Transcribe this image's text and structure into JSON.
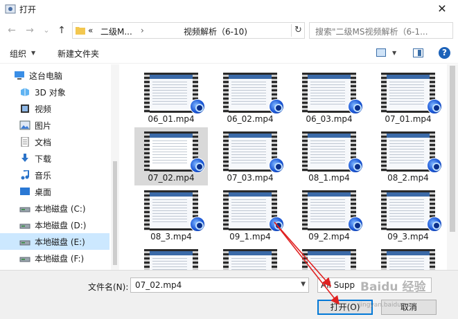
{
  "window": {
    "title": "打开",
    "close_glyph": "✕"
  },
  "nav": {
    "back_glyph": "←",
    "forward_glyph": "→",
    "recent_glyph": "⌄",
    "up_glyph": "↑",
    "crumbs": [
      "«",
      "二级M...",
      "›",
      "视频解析（6-10)"
    ],
    "dropdown_glyph": "⌄",
    "refresh_glyph": "↻"
  },
  "search": {
    "placeholder": "搜索\"二级MS视频解析（6-1..."
  },
  "toolbar": {
    "organize": "组织",
    "organize_arrow": "▼",
    "new_folder": "新建文件夹",
    "view_arrow": "▼",
    "help": "?"
  },
  "sidebar": {
    "items": [
      {
        "label": "这台电脑",
        "icon": "computer-icon"
      },
      {
        "label": "3D 对象",
        "icon": "cube-3d-icon"
      },
      {
        "label": "视频",
        "icon": "video-folder-icon"
      },
      {
        "label": "图片",
        "icon": "picture-folder-icon"
      },
      {
        "label": "文档",
        "icon": "document-folder-icon"
      },
      {
        "label": "下载",
        "icon": "download-arrow-icon"
      },
      {
        "label": "音乐",
        "icon": "music-note-icon"
      },
      {
        "label": "桌面",
        "icon": "desktop-icon"
      },
      {
        "label": "本地磁盘 (C:)",
        "icon": "drive-icon"
      },
      {
        "label": "本地磁盘 (D:)",
        "icon": "drive-icon"
      },
      {
        "label": "本地磁盘 (E:)",
        "icon": "drive-icon"
      },
      {
        "label": "本地磁盘 (F:)",
        "icon": "drive-icon"
      }
    ],
    "selected_index": 10
  },
  "files": [
    "06_01.mp4",
    "06_02.mp4",
    "06_03.mp4",
    "07_01.mp4",
    "07_02.mp4",
    "07_03.mp4",
    "08_1.mp4",
    "08_2.mp4",
    "08_3.mp4",
    "09_1.mp4",
    "09_2.mp4",
    "09_3.mp4",
    "",
    "",
    "",
    ""
  ],
  "selected_file_index": 4,
  "bottom": {
    "filename_label": "文件名(N):",
    "filename_value": "07_02.mp4",
    "filter_text": "All Supp",
    "open_button": "打开(O)",
    "cancel_button": "取消"
  },
  "watermark": {
    "main": "Baidu 经验",
    "sub": "jingyan.baidu.com"
  },
  "colors": {
    "selection": "#cce8ff",
    "annotation_arrow": "#e02020",
    "help_blue": "#1c62b9"
  }
}
